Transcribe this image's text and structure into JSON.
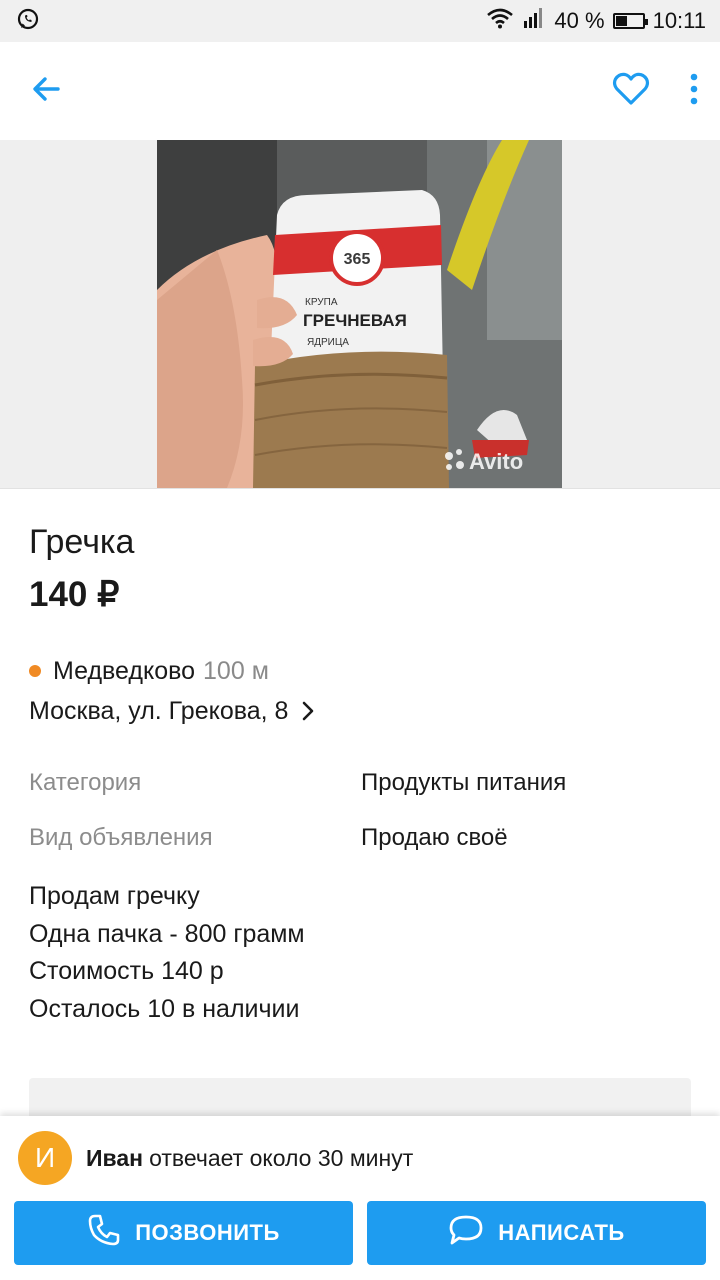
{
  "status": {
    "battery_text": "40 %",
    "time": "10:11",
    "battery_level": 0.4
  },
  "ad": {
    "title": "Гречка",
    "price": "140 ₽",
    "metro_station": "Медведково",
    "metro_distance": "100 м",
    "address": "Москва, ул. Грекова, 8",
    "params": [
      {
        "key": "Категория",
        "value": "Продукты питания"
      },
      {
        "key": "Вид объявления",
        "value": "Продаю своё"
      }
    ],
    "description": [
      "Продам гречку",
      "Одна пачка - 800 грамм",
      "Стоимость 140 р",
      "Осталось 10 в наличии"
    ]
  },
  "photo": {
    "package_brand": "365",
    "package_line1": "КРУПА",
    "package_line2": "ГРЕЧНЕВАЯ",
    "package_line3": "ЯДРИЦА",
    "watermark": "Avito"
  },
  "seller": {
    "avatar_letter": "И",
    "name": "Иван",
    "response_text": "отвечает около 30 минут"
  },
  "actions": {
    "call_label": "ПОЗВОНИТЬ",
    "write_label": "НАПИСАТЬ"
  },
  "colors": {
    "accent": "#1e9cf0",
    "metro_dot": "#f08a24",
    "avatar": "#f5a623"
  },
  "icons": [
    "whatsapp-icon",
    "wifi-icon",
    "signal-icon",
    "battery-icon",
    "back-arrow-icon",
    "favorite-heart-icon",
    "more-vert-icon",
    "chevron-right-icon",
    "phone-icon",
    "chat-bubble-icon"
  ]
}
